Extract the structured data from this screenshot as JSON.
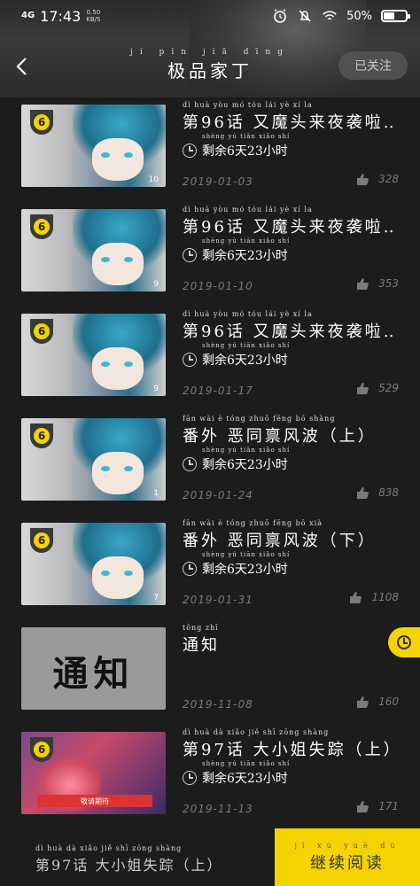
{
  "status_bar": {
    "network": "4G",
    "time": "17:43",
    "speed_value": "0.50",
    "speed_unit": "KB/S",
    "battery_text": "50%",
    "battery_level": 0.5,
    "icons": [
      "alarm-icon",
      "mute-icon",
      "wifi-icon",
      "battery-icon"
    ]
  },
  "header": {
    "title": "极品家丁",
    "title_pinyin": "jí  pǐn  jiā  dīng",
    "follow_label": "已关注"
  },
  "episodes": [
    {
      "title": "第96话 又魔头来夜袭啦…",
      "pinyin": "dì   huà   yòu  mó  tóu  lái  yè   xí   la",
      "remaining": "剩余6天23小时",
      "remaining_pinyin": "shèng yú  tiān  xiǎo shí",
      "date": "2019-01-03",
      "likes": "328",
      "thumb_num": "10"
    },
    {
      "title": "第96话 又魔头来夜袭啦…",
      "pinyin": "dì   huà   yòu  mó  tóu  lái  yè   xí   la",
      "remaining": "剩余6天23小时",
      "remaining_pinyin": "shèng yú  tiān  xiǎo shí",
      "date": "2019-01-10",
      "likes": "353",
      "thumb_num": "9"
    },
    {
      "title": "第96话 又魔头来夜袭啦…",
      "pinyin": "dì   huà   yòu  mó  tóu  lái  yè   xí   la",
      "remaining": "剩余6天23小时",
      "remaining_pinyin": "shèng yú  tiān  xiǎo shí",
      "date": "2019-01-17",
      "likes": "529",
      "thumb_num": "9"
    },
    {
      "title": "番外 恶同禀风波（上）",
      "pinyin": "fān wài   è   tóng zhuō fēng bō      shàng",
      "remaining": "剩余6天23小时",
      "remaining_pinyin": "shèng yú  tiān  xiǎo shí",
      "date": "2019-01-24",
      "likes": "838",
      "thumb_num": "1"
    },
    {
      "title": "番外 恶同禀风波（下）",
      "pinyin": "fān wài   è   tóng zhuō fēng bō      xià",
      "remaining": "剩余6天23小时",
      "remaining_pinyin": "shèng yú  tiān  xiǎo shí",
      "date": "2019-01-31",
      "likes": "1108",
      "thumb_num": "7"
    },
    {
      "title": "通知",
      "pinyin": "tōng zhī",
      "notice_thumb": "通知",
      "date": "2019-11-08",
      "likes": "160"
    },
    {
      "title": "第97话 大小姐失踪（上）",
      "pinyin": "dì   huà   dà  xiǎo  jiě  shī zōng    shàng",
      "remaining": "剩余6天23小时",
      "remaining_pinyin": "shèng yú  tiān  xiǎo shí",
      "date": "2019-11-13",
      "likes": "171",
      "banner": "敬请期待"
    }
  ],
  "bottom": {
    "last_read": "第97话 大小姐失踪（上）",
    "last_read_pinyin": "dì   huà  dà  xiǎo  jiě  shī zōng  shàng",
    "continue_label": "继续阅读",
    "continue_pinyin": "jì   xù   yuè  dú"
  }
}
